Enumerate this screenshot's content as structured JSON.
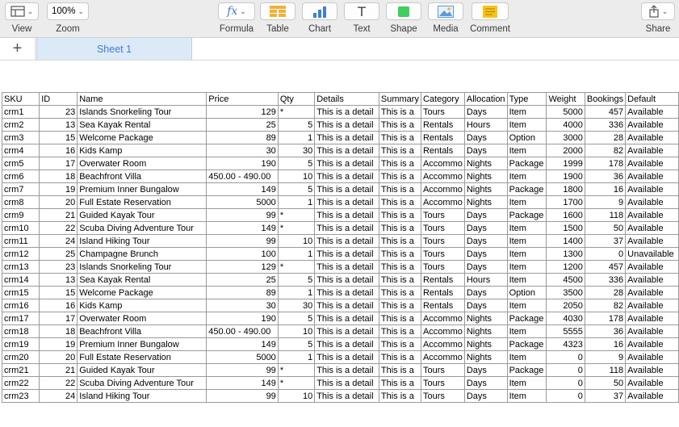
{
  "toolbar": {
    "view": "View",
    "zoom": "Zoom",
    "zoom_value": "100%",
    "formula": "Formula",
    "formula_glyph": "fx",
    "table": "Table",
    "chart": "Chart",
    "text": "Text",
    "text_glyph": "T",
    "shape": "Shape",
    "media": "Media",
    "comment": "Comment",
    "share": "Share"
  },
  "tabs": {
    "add_glyph": "+",
    "sheet1": "Sheet 1"
  },
  "colors": {
    "accent": "#3f7fd0",
    "shape_green": "#3fcf5f",
    "table_orange": "#f2b134",
    "comment_yellow": "#f7c31c",
    "media_blue": "#5b9bd5"
  },
  "columns": [
    "SKU",
    "ID",
    "Name",
    "Price",
    "Qty",
    "Details",
    "Summary",
    "Category",
    "Allocation",
    "Type",
    "Weight",
    "Bookings",
    "Default"
  ],
  "rows": [
    [
      "crm1",
      "23",
      "Islands Snorkeling Tour",
      "129",
      "*",
      "This is a detail",
      "This is a",
      "Tours",
      "Days",
      "Item",
      "5000",
      "457",
      "Available"
    ],
    [
      "crm2",
      "13",
      "Sea Kayak Rental",
      "25",
      "5",
      "This is a detail",
      "This is a",
      "Rentals",
      "Hours",
      "Item",
      "4000",
      "336",
      "Available"
    ],
    [
      "crm3",
      "15",
      "Welcome Package",
      "89",
      "1",
      "This is a detail",
      "This is a",
      "Rentals",
      "Days",
      "Option",
      "3000",
      "28",
      "Available"
    ],
    [
      "crm4",
      "16",
      "Kids Kamp",
      "30",
      "30",
      "This is a detail",
      "This is a",
      "Rentals",
      "Days",
      "Item",
      "2000",
      "82",
      "Available"
    ],
    [
      "crm5",
      "17",
      "Overwater Room",
      "190",
      "5",
      "This is a detail",
      "This is a",
      "Accommo",
      "Nights",
      "Package",
      "1999",
      "178",
      "Available"
    ],
    [
      "crm6",
      "18",
      "Beachfront Villa",
      "450.00 - 490.00",
      "10",
      "This is a detail",
      "This is a",
      "Accommo",
      "Nights",
      "Item",
      "1900",
      "36",
      "Available"
    ],
    [
      "crm7",
      "19",
      "Premium Inner Bungalow",
      "149",
      "5",
      "This is a detail",
      "This is a",
      "Accommo",
      "Nights",
      "Package",
      "1800",
      "16",
      "Available"
    ],
    [
      "crm8",
      "20",
      "Full Estate Reservation",
      "5000",
      "1",
      "This is a detail",
      "This is a",
      "Accommo",
      "Nights",
      "Item",
      "1700",
      "9",
      "Available"
    ],
    [
      "crm9",
      "21",
      "Guided Kayak Tour",
      "99",
      "*",
      "This is a detail",
      "This is a",
      "Tours",
      "Days",
      "Package",
      "1600",
      "118",
      "Available"
    ],
    [
      "crm10",
      "22",
      "Scuba Diving Adventure Tour",
      "149",
      "*",
      "This is a detail",
      "This is a",
      "Tours",
      "Days",
      "Item",
      "1500",
      "50",
      "Available"
    ],
    [
      "crm11",
      "24",
      "Island Hiking Tour",
      "99",
      "10",
      "This is a detail",
      "This is a",
      "Tours",
      "Days",
      "Item",
      "1400",
      "37",
      "Available"
    ],
    [
      "crm12",
      "25",
      "Champagne Brunch",
      "100",
      "1",
      "This is a detail",
      "This is a",
      "Tours",
      "Days",
      "Item",
      "1300",
      "0",
      "Unavailable"
    ],
    [
      "crm13",
      "23",
      "Islands Snorkeling Tour",
      "129",
      "*",
      "This is a detail",
      "This is a",
      "Tours",
      "Days",
      "Item",
      "1200",
      "457",
      "Available"
    ],
    [
      "crm14",
      "13",
      "Sea Kayak Rental",
      "25",
      "5",
      "This is a detail",
      "This is a",
      "Rentals",
      "Hours",
      "Item",
      "4500",
      "336",
      "Available"
    ],
    [
      "crm15",
      "15",
      "Welcome Package",
      "89",
      "1",
      "This is a detail",
      "This is a",
      "Rentals",
      "Days",
      "Option",
      "3500",
      "28",
      "Available"
    ],
    [
      "crm16",
      "16",
      "Kids Kamp",
      "30",
      "30",
      "This is a detail",
      "This is a",
      "Rentals",
      "Days",
      "Item",
      "2050",
      "82",
      "Available"
    ],
    [
      "crm17",
      "17",
      "Overwater Room",
      "190",
      "5",
      "This is a detail",
      "This is a",
      "Accommo",
      "Nights",
      "Package",
      "4030",
      "178",
      "Available"
    ],
    [
      "crm18",
      "18",
      "Beachfront Villa",
      "450.00 - 490.00",
      "10",
      "This is a detail",
      "This is a",
      "Accommo",
      "Nights",
      "Item",
      "5555",
      "36",
      "Available"
    ],
    [
      "crm19",
      "19",
      "Premium Inner Bungalow",
      "149",
      "5",
      "This is a detail",
      "This is a",
      "Accommo",
      "Nights",
      "Package",
      "4323",
      "16",
      "Available"
    ],
    [
      "crm20",
      "20",
      "Full Estate Reservation",
      "5000",
      "1",
      "This is a detail",
      "This is a",
      "Accommo",
      "Nights",
      "Item",
      "0",
      "9",
      "Available"
    ],
    [
      "crm21",
      "21",
      "Guided Kayak Tour",
      "99",
      "*",
      "This is a detail",
      "This is a",
      "Tours",
      "Days",
      "Package",
      "0",
      "118",
      "Available"
    ],
    [
      "crm22",
      "22",
      "Scuba Diving Adventure Tour",
      "149",
      "*",
      "This is a detail",
      "This is a",
      "Tours",
      "Days",
      "Item",
      "0",
      "50",
      "Available"
    ],
    [
      "crm23",
      "24",
      "Island Hiking Tour",
      "99",
      "10",
      "This is a detail",
      "This is a",
      "Tours",
      "Days",
      "Item",
      "0",
      "37",
      "Available"
    ]
  ]
}
